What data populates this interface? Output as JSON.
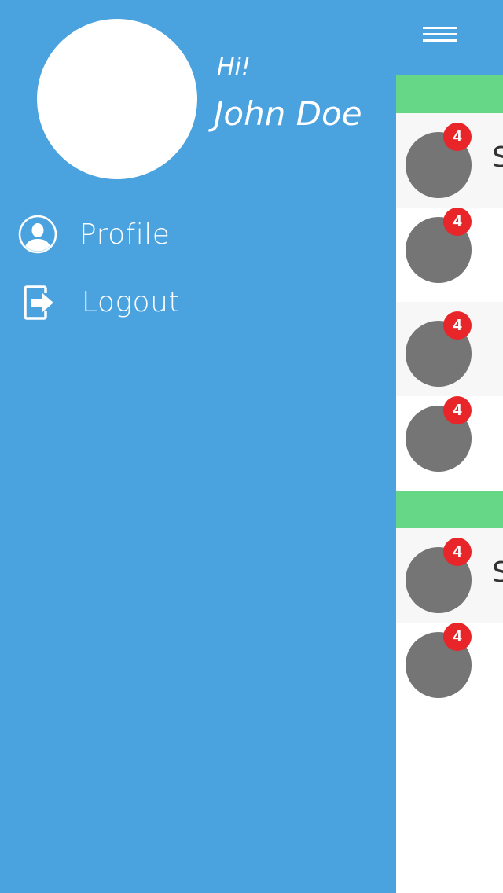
{
  "drawer": {
    "greeting": "Hi!",
    "user_name": "John Doe",
    "menu": [
      {
        "label": "Profile",
        "icon": "user-icon"
      },
      {
        "label": "Logout",
        "icon": "logout-icon"
      }
    ]
  },
  "main": {
    "menu_icon": "hamburger-icon",
    "rows": [
      {
        "badge": "4",
        "title": "S"
      },
      {
        "badge": "4",
        "title": ""
      },
      {
        "badge": "4",
        "title": ""
      },
      {
        "badge": "4",
        "title": ""
      },
      {
        "badge": "4",
        "title": "S"
      },
      {
        "badge": "4",
        "title": ""
      }
    ]
  },
  "colors": {
    "primary": "#4aa2df",
    "section": "#66d687",
    "badge": "#e8262a",
    "avatar_placeholder": "#757575"
  }
}
